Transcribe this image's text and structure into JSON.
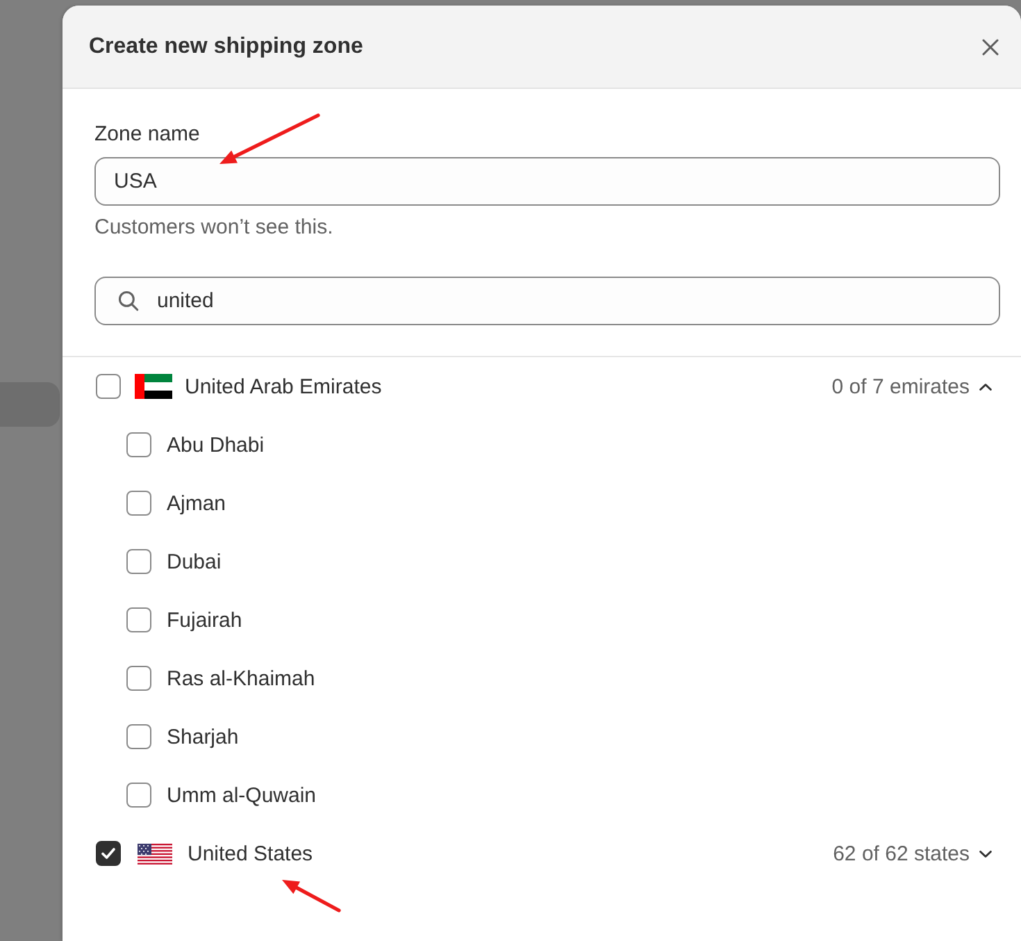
{
  "dialog": {
    "title": "Create new shipping zone"
  },
  "zone_name": {
    "label": "Zone name",
    "value": "USA",
    "help_text": "Customers won’t see this.",
    "annotated": true
  },
  "search": {
    "value": "united"
  },
  "countries": [
    {
      "name": "United Arab Emirates",
      "checked": false,
      "summary": "0 of 7 emirates",
      "expanded": true,
      "annotated": false,
      "regions": [
        {
          "name": "Abu Dhabi",
          "checked": false
        },
        {
          "name": "Ajman",
          "checked": false
        },
        {
          "name": "Dubai",
          "checked": false
        },
        {
          "name": "Fujairah",
          "checked": false
        },
        {
          "name": "Ras al-Khaimah",
          "checked": false
        },
        {
          "name": "Sharjah",
          "checked": false
        },
        {
          "name": "Umm al-Quwain",
          "checked": false
        }
      ]
    },
    {
      "name": "United States",
      "checked": true,
      "summary": "62 of 62 states",
      "expanded": false,
      "annotated": true
    }
  ]
}
